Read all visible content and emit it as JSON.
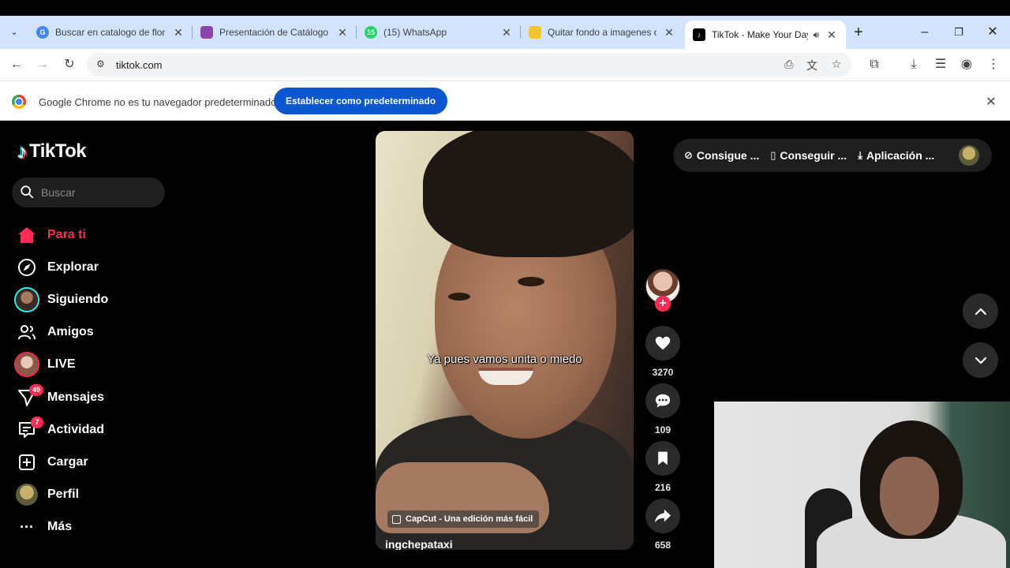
{
  "browser": {
    "tabs": [
      {
        "title": "Buscar en catalogo de flores",
        "favicon_color": "#4285f4"
      },
      {
        "title": "Presentación de Catálogo de",
        "favicon_color": "#8e44ad"
      },
      {
        "title": "(15) WhatsApp",
        "favicon_color": "#25d366",
        "favicon_text": "15"
      },
      {
        "title": "Quitar fondo a imagenes on",
        "favicon_color": "#f4c430"
      },
      {
        "title": "TikTok - Make Your Day",
        "favicon_color": "#000000",
        "active": true,
        "audio": true
      }
    ],
    "url": "tiktok.com",
    "infobar": {
      "message": "Google Chrome no es tu navegador predeterminado",
      "button": "Establecer como predeterminado"
    }
  },
  "tiktok": {
    "logo": "TikTok",
    "search_placeholder": "Buscar",
    "nav": [
      {
        "label": "Para ti",
        "icon": "home-icon",
        "active": true
      },
      {
        "label": "Explorar",
        "icon": "compass-icon"
      },
      {
        "label": "Siguiendo",
        "icon": "avatar"
      },
      {
        "label": "Amigos",
        "icon": "friends-icon"
      },
      {
        "label": "LIVE",
        "icon": "avatar"
      },
      {
        "label": "Mensajes",
        "icon": "messages-icon",
        "badge": "49"
      },
      {
        "label": "Actividad",
        "icon": "activity-icon",
        "badge": "7"
      },
      {
        "label": "Cargar",
        "icon": "upload-icon"
      },
      {
        "label": "Perfil",
        "icon": "avatar"
      },
      {
        "label": "Más",
        "icon": "more-icon"
      }
    ],
    "video": {
      "caption": "Ya pues vamos unita o miedo",
      "effect_label": "CapCut - Una edición más fácil",
      "username": "ingchepataxi"
    },
    "actions": {
      "likes": "3270",
      "comments": "109",
      "saves": "216",
      "shares": "658"
    },
    "top_right": {
      "coins": "Consigue ...",
      "get_app": "Conseguir ...",
      "download": "Aplicación ..."
    },
    "colors": {
      "accent": "#fe2c55",
      "background": "#000000",
      "chrome_tabstrip": "#d3e3fd",
      "chrome_button": "#0b57d0"
    }
  }
}
